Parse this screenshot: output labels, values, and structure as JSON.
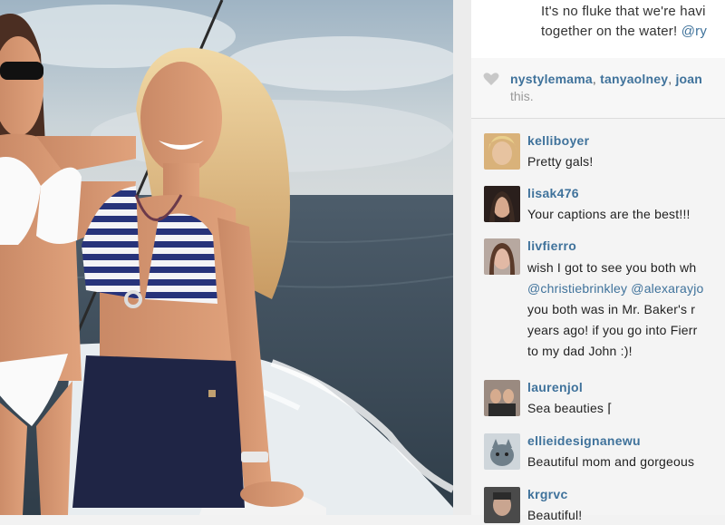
{
  "caption": {
    "line1": "It's no fluke that we're havi",
    "line2_text": "together on the water! ",
    "line2_mention": "@ry"
  },
  "likes": {
    "names": [
      "nystylemama",
      "tanyaolney",
      "joan"
    ],
    "suffix": "this."
  },
  "comments": [
    {
      "username": "kelliboyer",
      "lines": [
        "Pretty gals!"
      ]
    },
    {
      "username": "lisak476",
      "lines": [
        "Your captions are the best!!!"
      ]
    },
    {
      "username": "livfierro",
      "lines": [
        "wish I got to see you both wh",
        "@christiebrinkley @alexarayjo",
        "you both was in Mr. Baker's r",
        "years ago! if you go into Fierr",
        "to my dad John :)!"
      ]
    },
    {
      "username": "laurenjol",
      "lines": [
        "Sea beauties ⌈"
      ]
    },
    {
      "username": "ellieidesignanewu",
      "lines": [
        "Beautiful mom and gorgeous"
      ]
    },
    {
      "username": "krgrvc",
      "lines": [
        "Beautiful!"
      ]
    }
  ],
  "colors": {
    "link": "#3f729b",
    "text": "#222222",
    "muted": "#999999"
  }
}
